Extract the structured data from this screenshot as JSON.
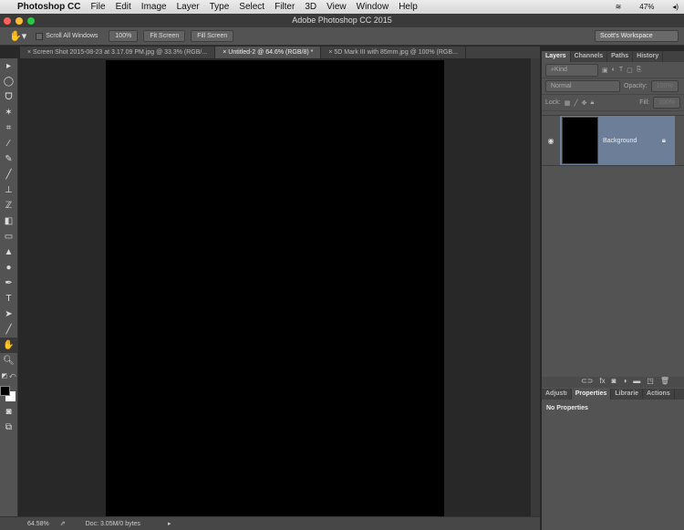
{
  "menubar": {
    "app": "Photoshop CC",
    "items": [
      "File",
      "Edit",
      "Image",
      "Layer",
      "Type",
      "Select",
      "Filter",
      "3D",
      "View",
      "Window",
      "Help"
    ],
    "battery": "47%"
  },
  "window": {
    "title": "Adobe Photoshop CC 2015"
  },
  "options": {
    "scroll_all": "Scroll All Windows",
    "zoom100": "100%",
    "fit": "Fit Screen",
    "fill": "Fill Screen",
    "workspace": "Scott's Workspace"
  },
  "tabs": [
    {
      "label": "Screen Shot 2015-08-23 at 3.17.09 PM.jpg @ 33.3% (RGB/..."
    },
    {
      "label": "Untitled-2 @ 64.6% (RGB/8) *"
    },
    {
      "label": "5D Mark III with 85mm.jpg @ 100% (RGB..."
    }
  ],
  "tools": [
    "move-tool",
    "marquee-tool",
    "lasso-tool",
    "magic-wand-tool",
    "crop-tool",
    "eyedropper-tool",
    "healing-brush-tool",
    "brush-tool",
    "clone-stamp-tool",
    "history-brush-tool",
    "eraser-tool",
    "gradient-tool",
    "blur-tool",
    "dodge-tool",
    "pen-tool",
    "type-tool",
    "path-selection-tool",
    "line-tool",
    "hand-tool",
    "zoom-tool"
  ],
  "status": {
    "zoom": "64.58%",
    "doc": "Doc: 3.05M/0 bytes"
  },
  "layers_panel": {
    "tabs": [
      "Layers",
      "Channels",
      "Paths",
      "History"
    ],
    "filter": "Kind",
    "blend": "Normal",
    "opacity_label": "Opacity:",
    "opacity": "100%",
    "lock_label": "Lock:",
    "fill_label": "Fill:",
    "fill": "100%",
    "layer_name": "Background"
  },
  "props_panel": {
    "tabs": [
      "Adjustı",
      "Properties",
      "Librarie",
      "Actions"
    ],
    "content": "No Properties"
  },
  "colors": {
    "foreground": "#000000",
    "background": "#ffffff",
    "layer_selected": "#6d7e98"
  }
}
